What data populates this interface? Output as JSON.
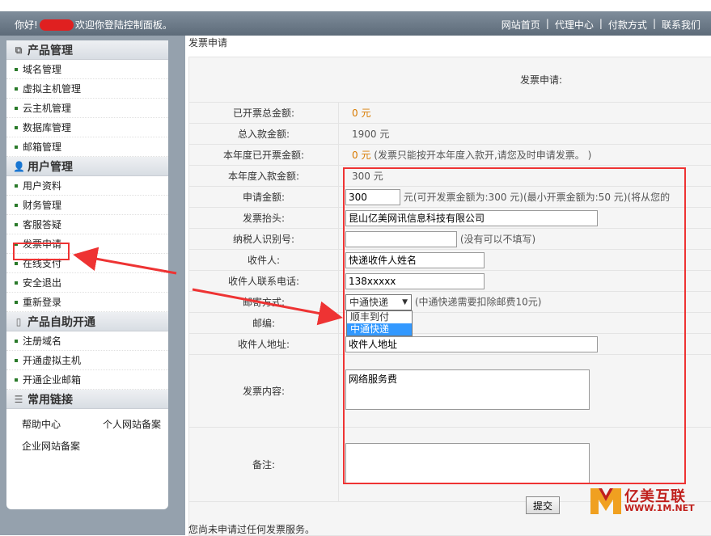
{
  "topbar": {
    "greeting_prefix": "你好!",
    "greeting_suffix": "欢迎你登陆控制面板。",
    "nav": [
      "网站首页",
      "代理中心",
      "付款方式",
      "联系我们"
    ]
  },
  "sidebar": {
    "sections": [
      {
        "title": "产品管理",
        "icon": "product-icon",
        "items": [
          "域名管理",
          "虚拟主机管理",
          "云主机管理",
          "数据库管理",
          "邮箱管理"
        ]
      },
      {
        "title": "用户管理",
        "icon": "user-icon",
        "items": [
          "用户资料",
          "财务管理",
          "客服答疑",
          "发票申请",
          "在线支付",
          "安全退出",
          "重新登录"
        ]
      },
      {
        "title": "产品自助开通",
        "icon": "self-service-icon",
        "items": [
          "注册域名",
          "开通虚拟主机",
          "开通企业邮箱"
        ]
      },
      {
        "title": "常用链接",
        "icon": "list-icon",
        "links": [
          "帮助中心",
          "个人网站备案",
          "企业网站备案"
        ]
      }
    ]
  },
  "main": {
    "breadcrumb": "发票申请",
    "form_title": "发票申请:",
    "rows": {
      "issued_total": {
        "label": "已开票总金额:",
        "value": "0 元"
      },
      "paid_total": {
        "label": "总入款金额:",
        "value": "1900 元"
      },
      "issued_year": {
        "label": "本年度已开票金额:",
        "value": "0 元",
        "note": "(发票只能按开本年度入款开,请您及时申请发票。 )"
      },
      "paid_year": {
        "label": "本年度入款金额:",
        "value": "300 元"
      },
      "amount": {
        "label": "申请金额:",
        "value": "300",
        "note": "元(可开发票金额为:300 元)(最小开票金额为:50 元)(将从您的"
      },
      "invoice_title": {
        "label": "发票抬头:",
        "value": "昆山亿美网讯信息科技有限公司"
      },
      "tax_id": {
        "label": "纳税人识别号:",
        "value": "",
        "note": "(没有可以不填写)"
      },
      "recipient": {
        "label": "收件人:",
        "value": "快递收件人姓名"
      },
      "phone": {
        "label": "收件人联系电话:",
        "value": "138xxxxx"
      },
      "shipping": {
        "label": "邮寄方式:",
        "selected": "中通快递",
        "options": [
          "顺丰到付",
          "中通快递"
        ],
        "note": "(中通快递需要扣除邮费10元)"
      },
      "postcode": {
        "label": "邮编:"
      },
      "address": {
        "label": "收件人地址:",
        "value": "收件人地址"
      },
      "content": {
        "label": "发票内容:",
        "value": "网络服务费"
      },
      "remark": {
        "label": "备注:",
        "value": ""
      }
    },
    "submit_label": "提交",
    "footnote": "您尚未申请过任何发票服务。"
  },
  "watermark": {
    "brand": "亿美互联",
    "url": "WWW.1M.NET"
  },
  "colors": {
    "annotation_red": "#e33333",
    "accent_orange": "#d87a00",
    "highlight_blue": "#3399ff"
  }
}
